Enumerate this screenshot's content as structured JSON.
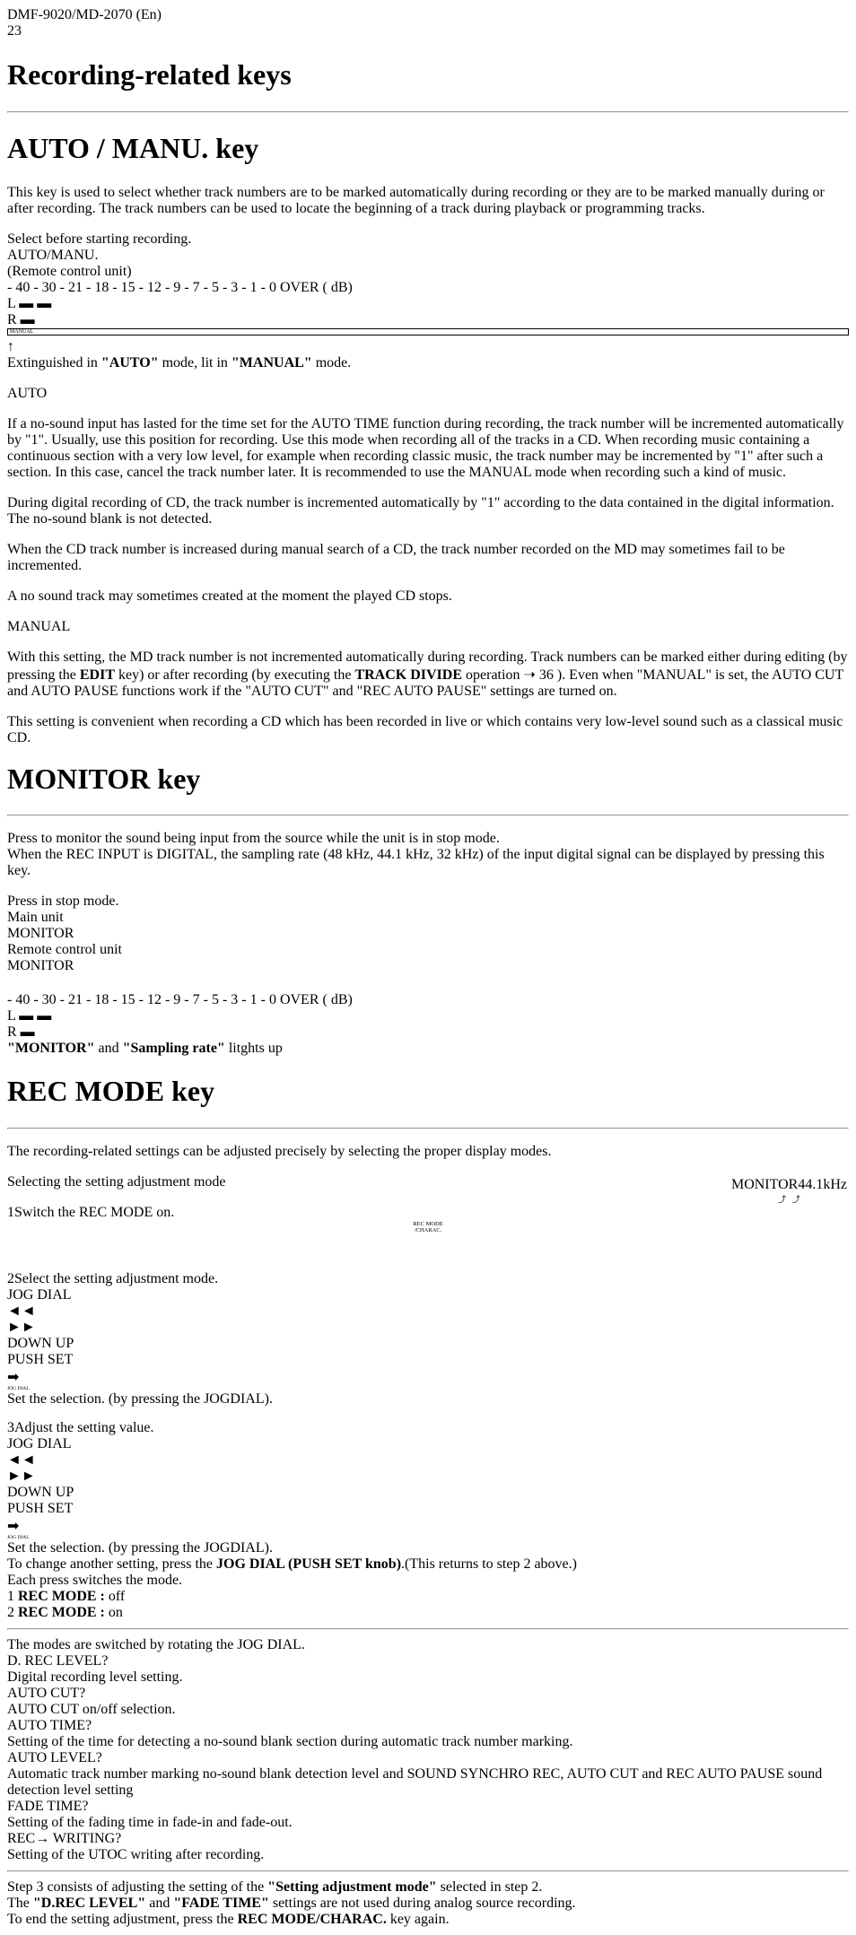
{
  "doc_id": "DMF-9020/MD-2070 (En)",
  "page_number": "23",
  "h_recording": "Recording-related keys",
  "h_auto_manu": "AUTO / MANU. key",
  "auto_manu_intro": "This key is used to select whether track numbers are to be marked automatically during recording or they are to be marked manually during or after recording. The track numbers can be used to locate the beginning of a track during playback or programming tracks.",
  "panel1": {
    "title": "Select before starting recording.",
    "sub": "AUTO/MANU.",
    "remote": "(Remote control unit)"
  },
  "meter_scale": "- 40  - 30  - 21  - 18  - 15  - 12  - 9  - 7  - 5  - 3  - 1  - 0   OVER ( dB)",
  "meter_L": "L",
  "meter_R": "R",
  "meter_ind": "MANUAL",
  "meter_caption_a": "Extinguished in ",
  "meter_caption_b": "\"AUTO\"",
  "meter_caption_c": " mode, lit in ",
  "meter_caption_d": "\"MANUAL\"",
  "meter_caption_e": " mode.",
  "auto_h": "AUTO",
  "auto_p1": "If a no-sound input has lasted for the time set for the AUTO TIME function during recording, the track number will be incremented automatically by \"1\". Usually, use this position for recording. Use this mode when recording all of the tracks in a CD. When recording music containing a continuous section with a very low level, for example when recording classic music, the track number may be incremented by \"1\" after such a section. In this case, cancel the track number later. It is recommended to use the MANUAL mode when recording such a kind of music.",
  "auto_p2": "During digital recording of CD, the track number is incremented automatically by \"1\" according to the data contained in the digital information. The no-sound blank is not detected.",
  "auto_p3": "When the CD track number is increased during manual search of a CD, the track number recorded on the MD may sometimes fail to be incremented.",
  "auto_p4": "A no sound track may sometimes created at the moment the played CD stops.",
  "manual_h": "MANUAL",
  "manual_p1a": "With this setting, the MD track number is not incremented automatically during recording. Track numbers can be marked either during editing (by pressing the ",
  "manual_p1_edit": "EDIT",
  "manual_p1b": " key) or after recording (by executing the ",
  "manual_p1_td": "TRACK DIVIDE",
  "manual_p1c": " operation ➝ ",
  "manual_p1_page": "36",
  "manual_p1d": " ). Even when \"MANUAL\" is set, the AUTO CUT and AUTO PAUSE functions work if the \"AUTO CUT\" and \"REC AUTO PAUSE\" settings are turned on.",
  "manual_p2": "This setting is convenient when recording a CD which has been recorded in live or which contains very low-level sound such as a classical music CD.",
  "h_monitor": "MONITOR key",
  "monitor_intro": "Press to monitor the sound being input from the source while the unit is in stop mode.\nWhen the REC INPUT is DIGITAL, the sampling rate (48 kHz, 44.1 kHz, 32 kHz) of the input digital signal can be displayed by pressing this key.",
  "monitor_panel": {
    "top": "Press in stop mode.",
    "main": "Main unit",
    "remote": "Remote control unit",
    "sub": "MONITOR"
  },
  "monitor_tag1": "MONITOR",
  "monitor_tag2": "44.1kHz",
  "monitor_caption_a": "\"MONITOR\"",
  "monitor_caption_b": " and ",
  "monitor_caption_c": "\"Sampling rate\"",
  "monitor_caption_d": " litghts up",
  "h_recmode": "REC MODE key",
  "recmode_intro": "The recording-related settings can be adjusted precisely by selecting the proper display modes.",
  "recmode_sub": "Selecting the setting adjustment mode",
  "steps": {
    "s1": "Switch the REC MODE on.",
    "s1_sub": "REC MODE\n/CHARAC.",
    "s2": "Select the setting adjustment mode.",
    "s3": "Adjust the setting value.",
    "jog_caption": "Set the selection. (by pressing the JOGDIAL).",
    "jog_top": "JOG DIAL",
    "jog_left": "◄◄",
    "jog_right": "►►",
    "jog_bottom1": "DOWN                UP",
    "jog_bottom2": "PUSH SET",
    "bottom_a": "To change another setting, press the ",
    "bottom_b": "JOG DIAL (PUSH SET knob)",
    "bottom_c": ".(This returns to step ",
    "bottom_d": " above.)"
  },
  "right": {
    "each_press": "Each press switches the mode.",
    "rm_label": "REC MODE :",
    "rm_off": " off",
    "rm_on": " on",
    "modes_title": "The modes are switched by rotating the JOG DIAL.",
    "modes": [
      {
        "name": "D. REC LEVEL?",
        "desc": "Digital recording level setting."
      },
      {
        "name": "AUTO CUT?",
        "desc": "AUTO CUT on/off selection."
      },
      {
        "name": "AUTO TIME?",
        "desc": "Setting of the time for detecting a no-sound blank section during automatic track number marking."
      },
      {
        "name": "AUTO LEVEL?",
        "desc": "Automatic track number marking no-sound blank detection level and SOUND SYNCHRO REC, AUTO CUT and REC AUTO PAUSE sound detection level setting"
      },
      {
        "name": "FADE TIME?",
        "desc": "Setting of the fading time in fade-in and fade-out."
      },
      {
        "name": "REC→ WRITING?",
        "desc": "Setting of the UTOC writing after recording."
      }
    ],
    "b1a": "Step ",
    "b1b": " consists of adjusting the setting of the ",
    "b1c": "\"Setting adjustment mode\"",
    "b1d": " selected in step ",
    "b1e": ".",
    "b2a": "The ",
    "b2b": "\"D.REC LEVEL\"",
    "b2c": " and ",
    "b2d": "\"FADE TIME\"",
    "b2e": " settings are not used during analog source recording.",
    "b3a": "To end the setting adjustment, press the ",
    "b3b": "REC MODE/CHARAC.",
    "b3c": " key again."
  }
}
